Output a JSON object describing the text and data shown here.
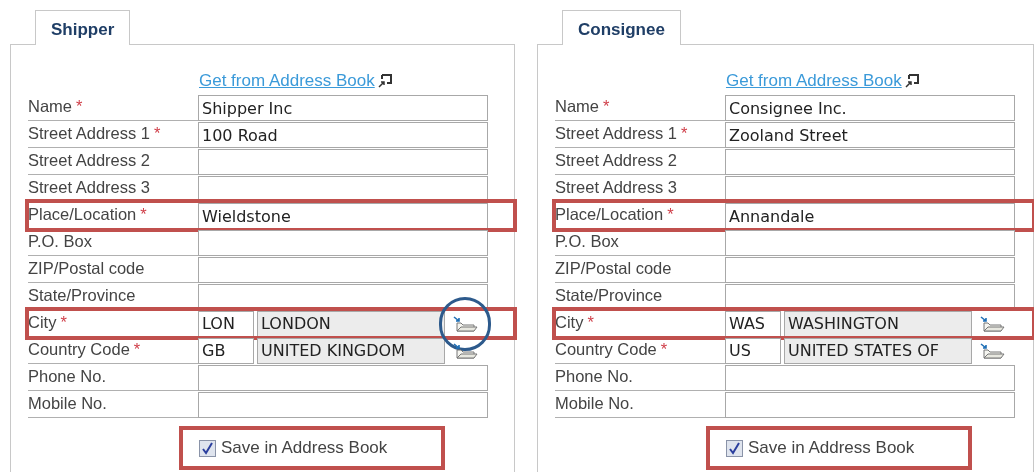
{
  "panels": [
    {
      "tab": {
        "label": "Shipper",
        "selected": true
      },
      "link": "Get from Address Book",
      "fields": [
        {
          "kind": "text",
          "label": "Name",
          "mark": "*",
          "value": "Shipper Inc",
          "highlighted": false
        },
        {
          "kind": "text",
          "label": "Street Address 1",
          "mark": "*",
          "value": "100 Road",
          "highlighted": false
        },
        {
          "kind": "text",
          "label": "Street Address 2",
          "highlighted": false
        },
        {
          "kind": "text",
          "label": "Street Address 3",
          "highlighted": false
        },
        {
          "kind": "text",
          "label": "Place/Location",
          "mark": "*",
          "value": "Wieldstone",
          "highlighted": true
        },
        {
          "kind": "text",
          "label": "P.O. Box",
          "highlighted": false
        },
        {
          "kind": "text",
          "label": "ZIP/Postal code",
          "highlighted": false
        },
        {
          "kind": "text",
          "label": "State/Province",
          "highlighted": false
        },
        {
          "kind": "lookup",
          "label": "City",
          "mark": "*",
          "code": "LON",
          "value": "LONDON",
          "highlighted": true,
          "circled": true
        },
        {
          "kind": "lookup",
          "label": "Country Code",
          "mark": "*",
          "code": "GB",
          "value": "UNITED KINGDOM",
          "highlighted": false,
          "circled": false
        },
        {
          "kind": "text",
          "label": "Phone No.",
          "highlighted": false
        },
        {
          "kind": "text",
          "label": "Mobile No.",
          "highlighted": false
        }
      ],
      "save": {
        "label": "Save in Address Book",
        "checked": true,
        "highlighted": true
      }
    },
    {
      "tab": {
        "label": "Consignee",
        "selected": true
      },
      "link": "Get from Address Book",
      "fields": [
        {
          "kind": "text",
          "label": "Name",
          "mark": "*",
          "value": "Consignee Inc.",
          "highlighted": false
        },
        {
          "kind": "text",
          "label": "Street Address 1",
          "mark": "*",
          "value": "Zooland Street",
          "highlighted": false
        },
        {
          "kind": "text",
          "label": "Street Address 2",
          "highlighted": false
        },
        {
          "kind": "text",
          "label": "Street Address 3",
          "highlighted": false
        },
        {
          "kind": "text",
          "label": "Place/Location",
          "mark": "*",
          "value": "Annandale",
          "highlighted": true
        },
        {
          "kind": "text",
          "label": "P.O. Box",
          "highlighted": false
        },
        {
          "kind": "text",
          "label": "ZIP/Postal code",
          "highlighted": false
        },
        {
          "kind": "text",
          "label": "State/Province",
          "highlighted": false
        },
        {
          "kind": "lookup",
          "label": "City",
          "mark": "*",
          "code": "WAS",
          "value": "WASHINGTON",
          "highlighted": true,
          "circled": false
        },
        {
          "kind": "lookup",
          "label": "Country Code",
          "mark": "*",
          "code": "US",
          "value": "UNITED STATES OF",
          "highlighted": false,
          "circled": false
        },
        {
          "kind": "text",
          "label": "Phone No.",
          "highlighted": false
        },
        {
          "kind": "text",
          "label": "Mobile No.",
          "highlighted": false
        }
      ],
      "save": {
        "label": "Save in Address Book",
        "checked": true,
        "highlighted": true
      }
    }
  ]
}
